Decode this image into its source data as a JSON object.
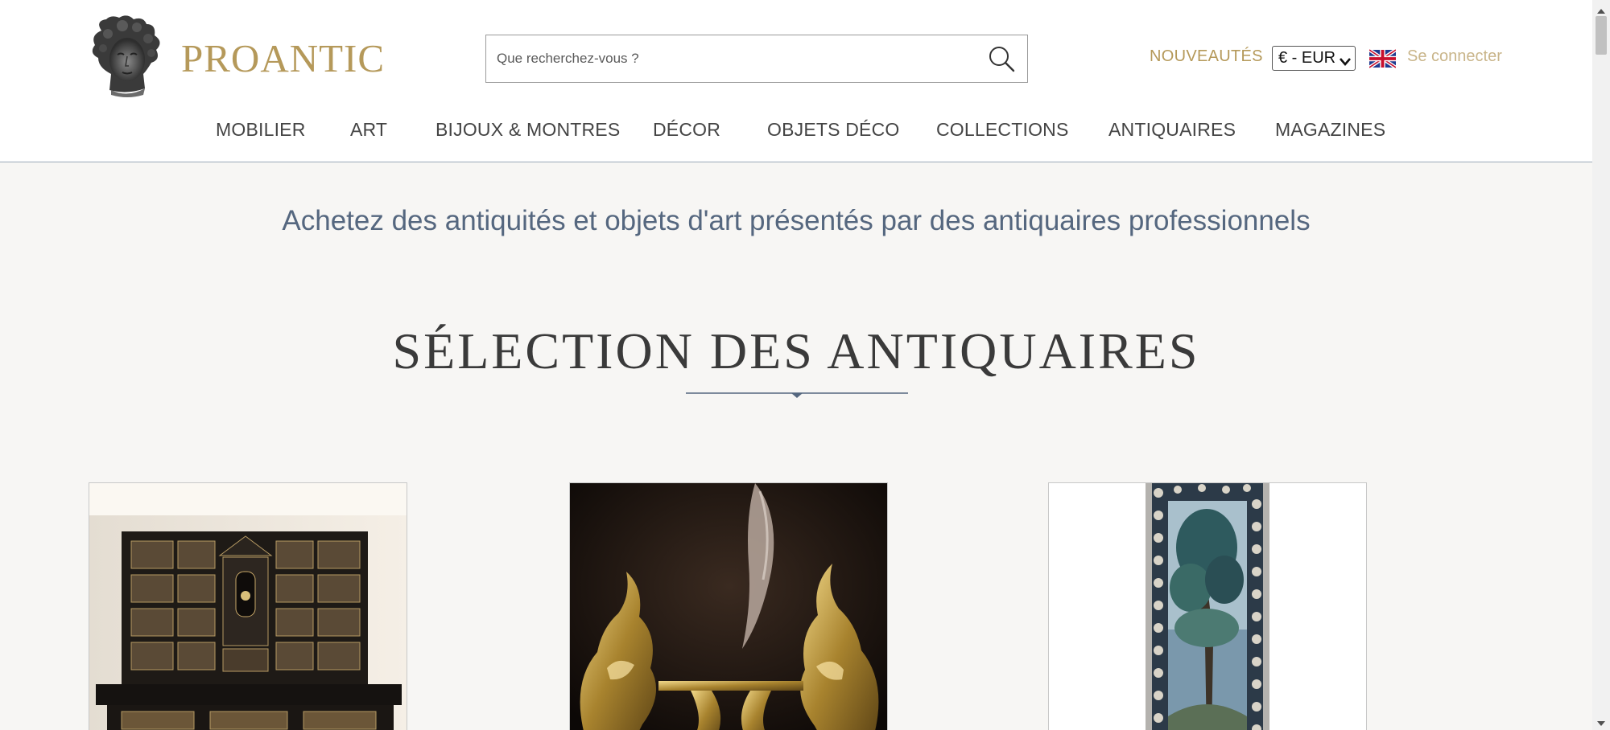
{
  "header": {
    "brand": "PROANTIC",
    "search_placeholder": "Que recherchez-vous ?",
    "new_items": "NOUVEAUTÉS",
    "currency": "€ - EUR",
    "login": "Se connecter"
  },
  "nav": {
    "items": [
      {
        "label": "MOBILIER"
      },
      {
        "label": "ART"
      },
      {
        "label": "BIJOUX & MONTRES"
      },
      {
        "label": "DÉCOR"
      },
      {
        "label": "OBJETS DÉCO"
      },
      {
        "label": "COLLECTIONS"
      },
      {
        "label": "ANTIQUAIRES"
      },
      {
        "label": "MAGAZINES"
      }
    ]
  },
  "main": {
    "tagline": "Achetez des antiquités et objets d'art présentés par des antiquaires professionnels",
    "section_title": "SÉLECTION DES ANTIQUAIRES"
  },
  "colors": {
    "gold": "#b5995a",
    "slate": "#55677f",
    "background": "#f7f6f4"
  },
  "icons": [
    "logo-bust-icon",
    "search-icon",
    "uk-flag-icon",
    "caret-down-icon",
    "divider-diamond-icon"
  ]
}
